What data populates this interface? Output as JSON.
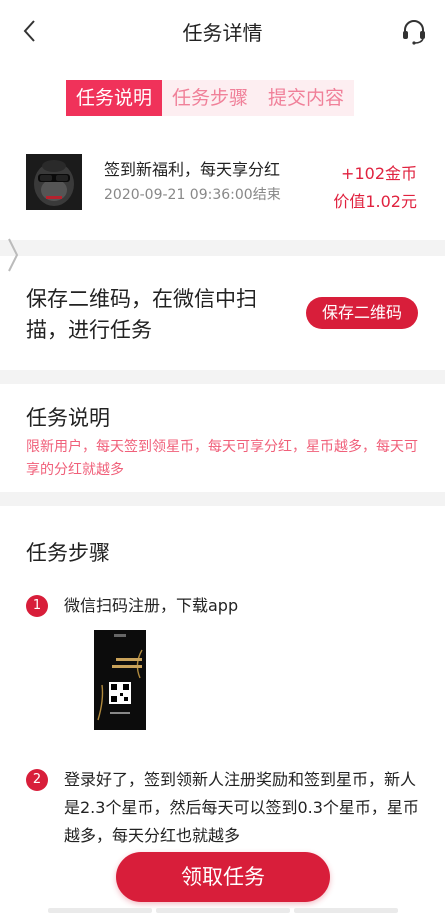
{
  "header": {
    "title": "任务详情",
    "back_icon": "chevron-left-icon",
    "support_icon": "headset-icon"
  },
  "tabs": [
    {
      "label": "任务说明",
      "active": true
    },
    {
      "label": "任务步骤",
      "active": false
    },
    {
      "label": "提交内容",
      "active": false
    }
  ],
  "task": {
    "title": "签到新福利，每天享分红",
    "end_time": "2020-09-21 09:36:00结束",
    "reward": "+102金币",
    "value": "价值1.02元"
  },
  "qr": {
    "text": "保存二维码，在微信中扫描，进行任务",
    "button": "保存二维码"
  },
  "description": {
    "title": "任务说明",
    "text": "限新用户，每天签到领星币，每天可享分红，星币越多，每天可享的分红就越多"
  },
  "steps": {
    "title": "任务步骤",
    "items": [
      {
        "number": "1",
        "text": "微信扫码注册，下载app"
      },
      {
        "number": "2",
        "text": "登录好了，签到领新人注册奖励和签到星币，新人是2.3个星币，然后每天可以签到0.3个星币，星币越多，每天分红也就越多"
      }
    ]
  },
  "accept_button": "领取任务",
  "colors": {
    "accent": "#d81e3a",
    "tab_active": "#f0325a",
    "tab_bg": "#fdeef1",
    "desc_text": "#f0607a"
  }
}
